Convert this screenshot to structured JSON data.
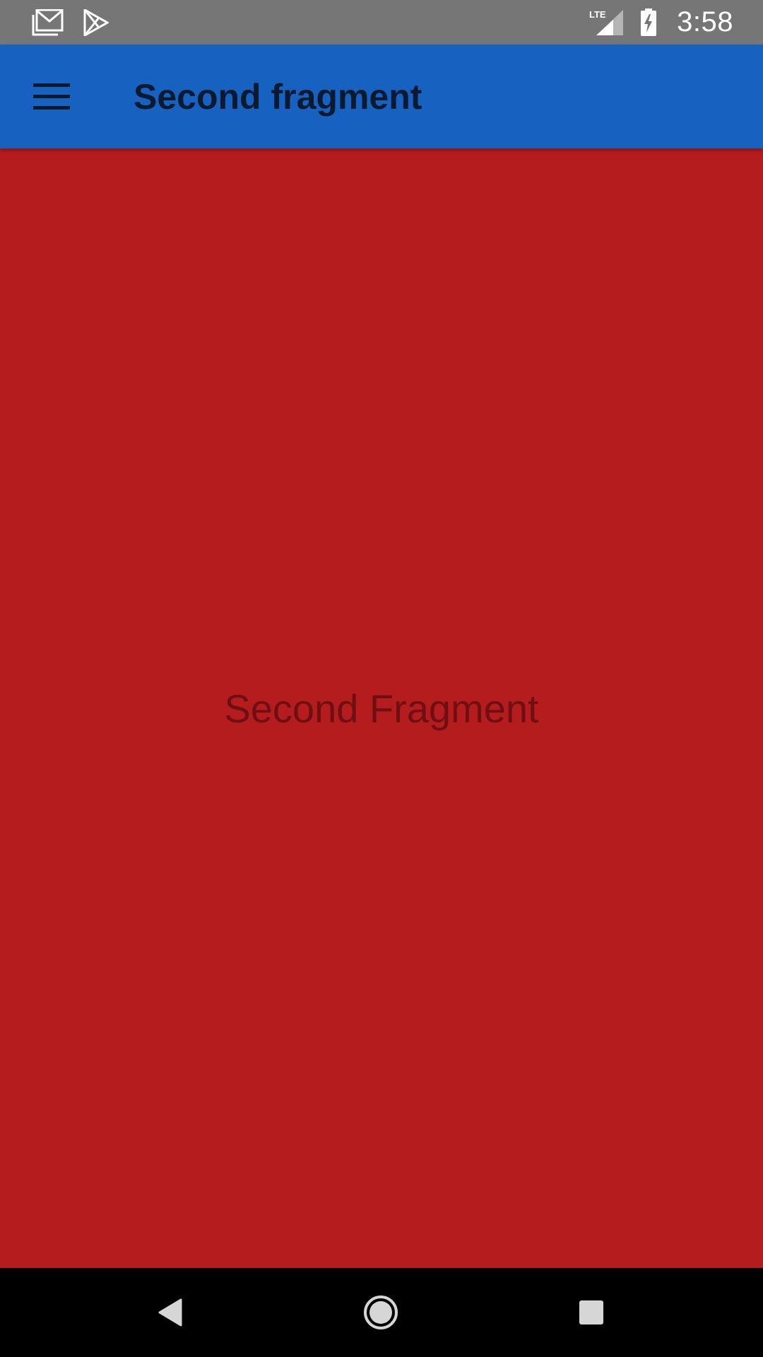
{
  "status_bar": {
    "time": "3:58",
    "network_label": "LTE",
    "icons": [
      "gmail-icon",
      "play-store-icon",
      "lte-signal-icon",
      "battery-charging-icon"
    ]
  },
  "app_bar": {
    "title": "Second fragment",
    "background": "#1762c1",
    "menu_icon": "hamburger-menu-icon"
  },
  "content": {
    "text": "Second Fragment",
    "background": "#b41c1e",
    "text_color": "#6e1012"
  },
  "nav_bar": {
    "buttons": [
      "back-icon",
      "home-icon",
      "recents-icon"
    ]
  }
}
